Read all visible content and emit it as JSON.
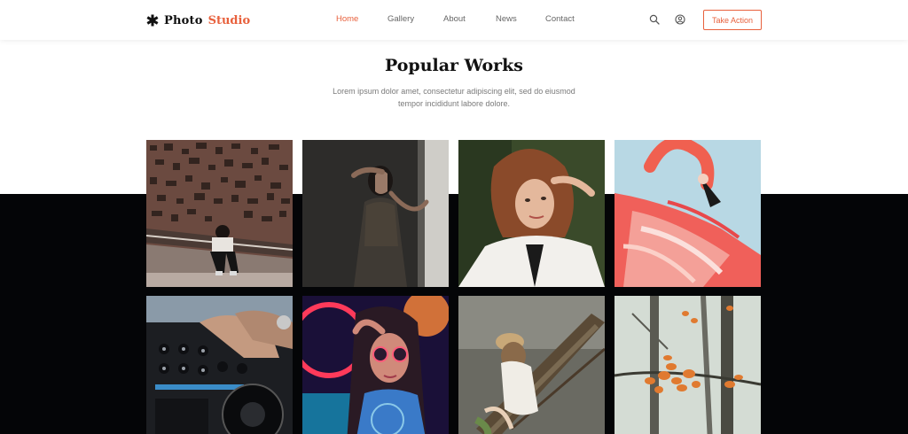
{
  "brand": {
    "name": "Photo",
    "accent": "Studio",
    "icon": "asterisk-icon"
  },
  "nav": {
    "home": "Home",
    "gallery": "Gallery",
    "about": "About",
    "news": "News",
    "contact": "Contact"
  },
  "header_actions": {
    "search_icon": "search-icon",
    "user_icon": "user-icon",
    "cta_label": "Take Action"
  },
  "section": {
    "title": "Popular Works",
    "subtitle_line1": "Lorem ipsum dolor amet, consectetur adipiscing elit, sed do eiusmod",
    "subtitle_line2": "tempor incididunt labore dolore."
  },
  "gallery": [
    {
      "subject": "man crouching by patterned wall"
    },
    {
      "subject": "woman in dark room"
    },
    {
      "subject": "red-haired woman in white shirt"
    },
    {
      "subject": "flamingo"
    },
    {
      "subject": "dj mixer"
    },
    {
      "subject": "woman with neon sunglasses"
    },
    {
      "subject": "woman sitting in boat"
    },
    {
      "subject": "autumn leaves in foggy forest"
    }
  ],
  "colors": {
    "accent": "#e8613d",
    "dark_band": "#040507",
    "text": "#111111",
    "muted": "#7a7a7a"
  }
}
